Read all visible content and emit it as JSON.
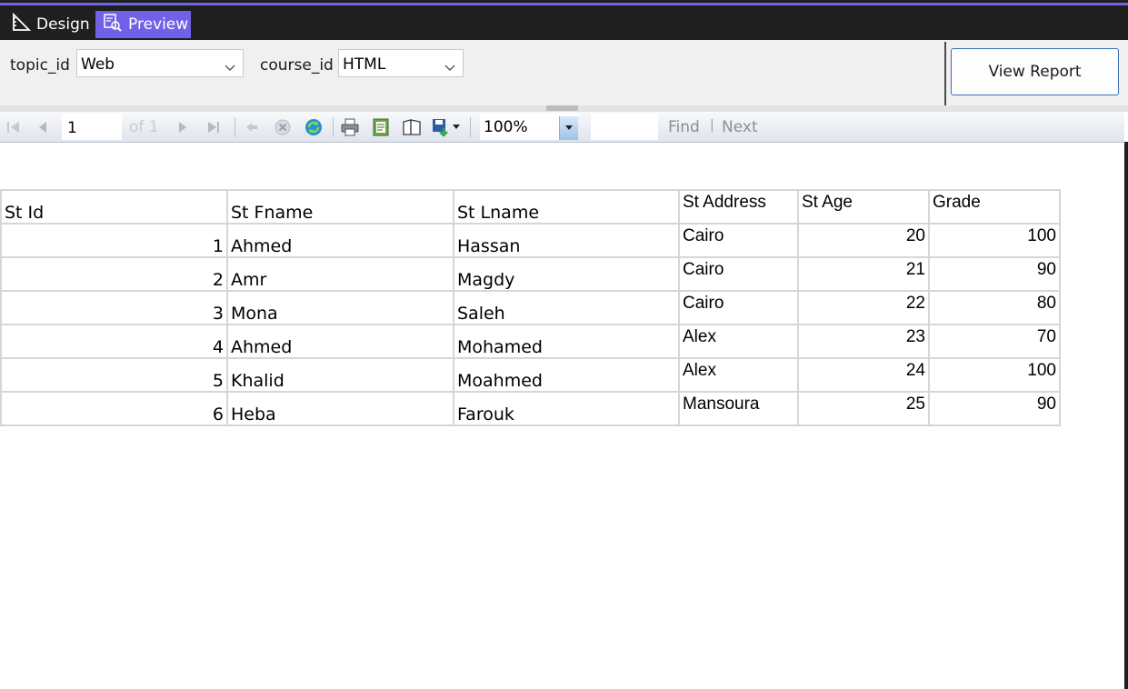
{
  "tabs": [
    {
      "label": "Design",
      "icon": "ruler-triangle-icon",
      "active": false
    },
    {
      "label": "Preview",
      "icon": "preview-icon",
      "active": true
    }
  ],
  "parameters": {
    "topic": {
      "label": "topic_id",
      "value": "Web"
    },
    "course": {
      "label": "course_id",
      "value": "HTML"
    },
    "view_report_label": "View Report"
  },
  "toolbar": {
    "page_value": "1",
    "page_of": "of 1",
    "zoom_value": "100%",
    "find_label": "Find",
    "find_separator": "|",
    "next_label": "Next"
  },
  "report": {
    "columns": [
      "St Id",
      "St Fname",
      "St Lname",
      "St Address",
      "St Age",
      "Grade"
    ],
    "rows": [
      [
        "1",
        "Ahmed",
        "Hassan",
        "Cairo",
        "20",
        "100"
      ],
      [
        "2",
        "Amr",
        "Magdy",
        "Cairo",
        "21",
        "90"
      ],
      [
        "3",
        "Mona",
        "Saleh",
        "Cairo",
        "22",
        "80"
      ],
      [
        "4",
        "Ahmed",
        "Mohamed",
        "Alex",
        "23",
        "70"
      ],
      [
        "5",
        "Khalid",
        "Moahmed",
        "Alex",
        "24",
        "100"
      ],
      [
        "6",
        "Heba",
        "Farouk",
        "Mansoura",
        "25",
        "90"
      ]
    ]
  },
  "colors": {
    "accent": "#7160e8",
    "dark_bg": "#1f1f1f"
  }
}
